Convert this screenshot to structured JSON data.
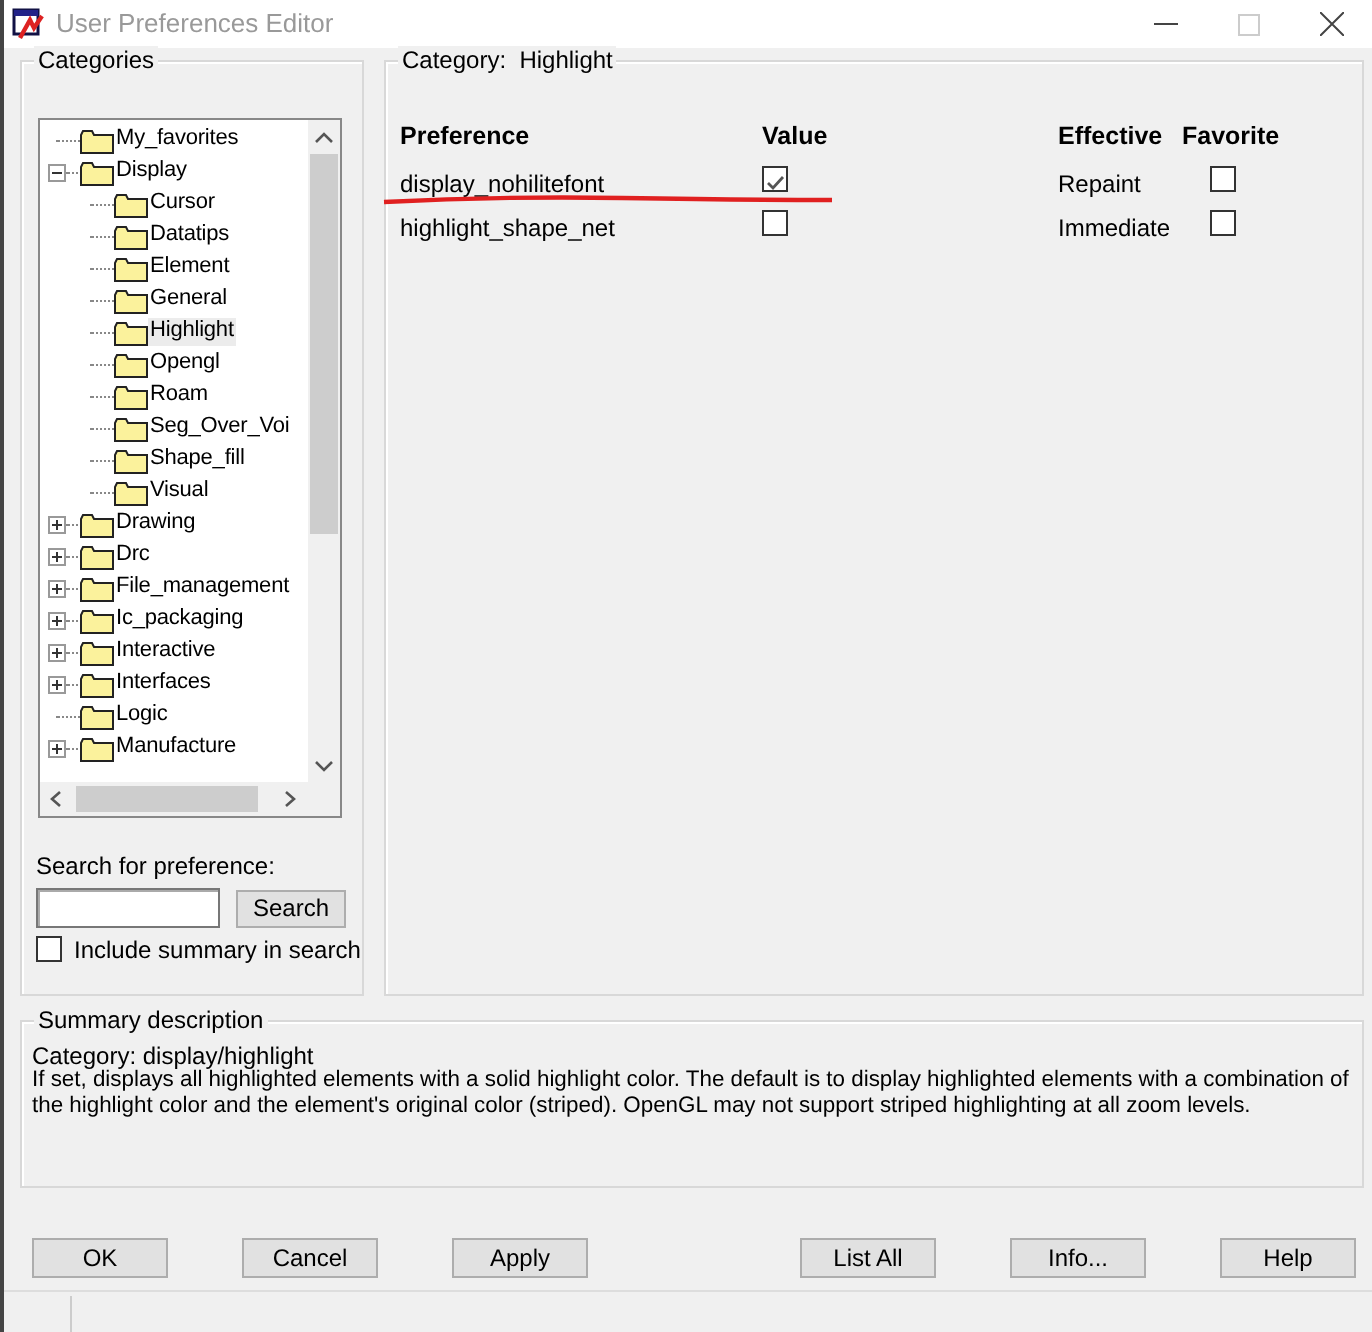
{
  "window": {
    "title": "User Preferences Editor"
  },
  "categories": {
    "title": "Categories",
    "tree": [
      {
        "label": "My_favorites",
        "selected": false
      },
      {
        "label": "Display",
        "selected": false,
        "expanded": true,
        "children": [
          {
            "label": "Cursor",
            "selected": false
          },
          {
            "label": "Datatips",
            "selected": false
          },
          {
            "label": "Element",
            "selected": false
          },
          {
            "label": "General",
            "selected": false
          },
          {
            "label": "Highlight",
            "selected": true
          },
          {
            "label": "Opengl",
            "selected": false
          },
          {
            "label": "Roam",
            "selected": false
          },
          {
            "label": "Seg_Over_Voi",
            "selected": false
          },
          {
            "label": "Shape_fill",
            "selected": false
          },
          {
            "label": "Visual",
            "selected": false
          }
        ]
      },
      {
        "label": "Drawing",
        "selected": false,
        "expanded": false
      },
      {
        "label": "Drc",
        "selected": false,
        "expanded": false
      },
      {
        "label": "File_management",
        "selected": false,
        "expanded": false
      },
      {
        "label": "Ic_packaging",
        "selected": false,
        "expanded": false
      },
      {
        "label": "Interactive",
        "selected": false,
        "expanded": false
      },
      {
        "label": "Interfaces",
        "selected": false,
        "expanded": false
      },
      {
        "label": "Logic",
        "selected": false
      },
      {
        "label": "Manufacture",
        "selected": false,
        "expanded": false
      }
    ]
  },
  "search": {
    "label": "Search for preference:",
    "button": "Search",
    "include_summary": {
      "label": "Include summary in search",
      "checked": false
    }
  },
  "category_panel": {
    "label": "Category:",
    "value": "Highlight",
    "columns": [
      "Preference",
      "Value",
      "Effective",
      "Favorite"
    ],
    "rows": [
      {
        "preference": "display_nohilitefont",
        "value": true,
        "effective": "Repaint",
        "favorite": false,
        "underlined": true
      },
      {
        "preference": "highlight_shape_net",
        "value": false,
        "effective": "Immediate",
        "favorite": false,
        "underlined": false
      }
    ]
  },
  "summary": {
    "title": "Summary description",
    "category": "Category: display/highlight",
    "lines": [
      "If set, displays all highlighted elements with a solid highlight color. The default is to display highlighted elements with a combination of",
      "the highlight color and the element's original color (striped). OpenGL may not support striped highlighting at all zoom levels."
    ]
  },
  "buttons": [
    "OK",
    "Cancel",
    "Apply",
    "List All",
    "Info...",
    "Help"
  ]
}
